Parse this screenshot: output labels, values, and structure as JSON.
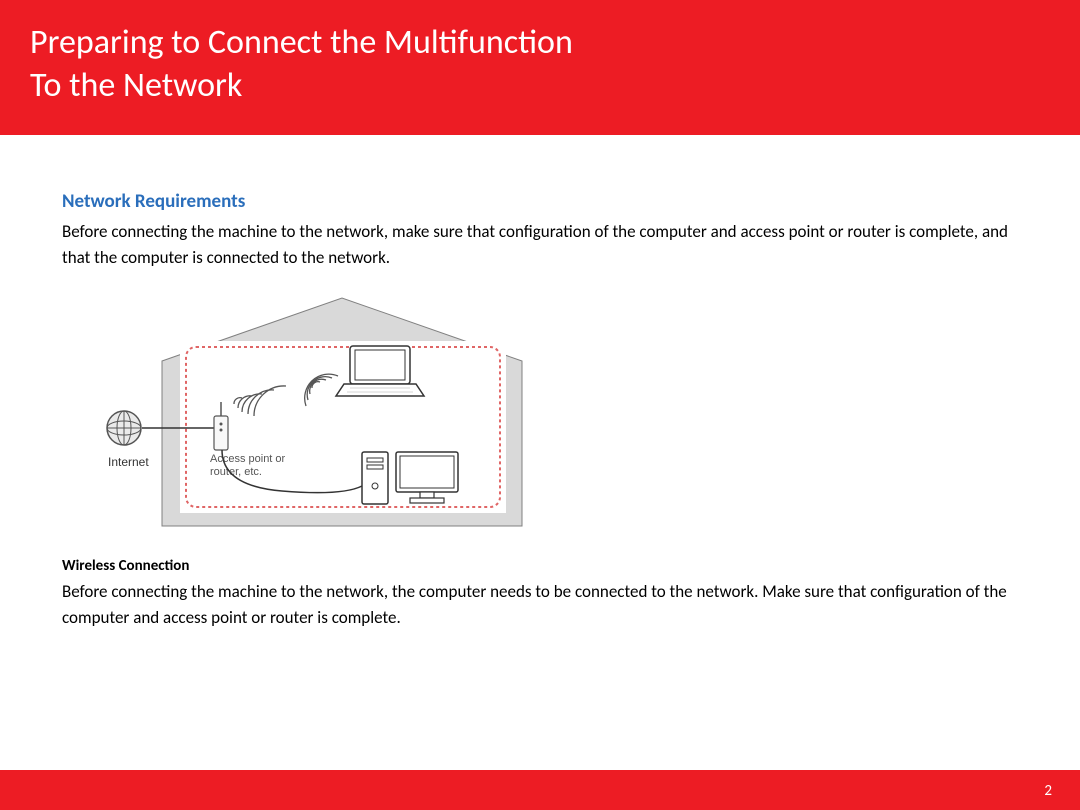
{
  "header": {
    "title_line1": "Preparing to Connect the Multifunction",
    "title_line2": "To the Network"
  },
  "section": {
    "heading": "Network Requirements",
    "intro": "Before connecting the machine to the network, make sure that configuration of the computer and access point or router is complete, and that the computer is connected to the network."
  },
  "diagram": {
    "internet_label": "Internet",
    "ap_label_line1": "Access point or",
    "ap_label_line2": "router, etc."
  },
  "wireless": {
    "subheading": "Wireless Connection",
    "text": "Before connecting the machine to the network, the computer needs to be connected to the network. Make sure that configuration of the computer and access point or router is complete."
  },
  "page_number": "2"
}
